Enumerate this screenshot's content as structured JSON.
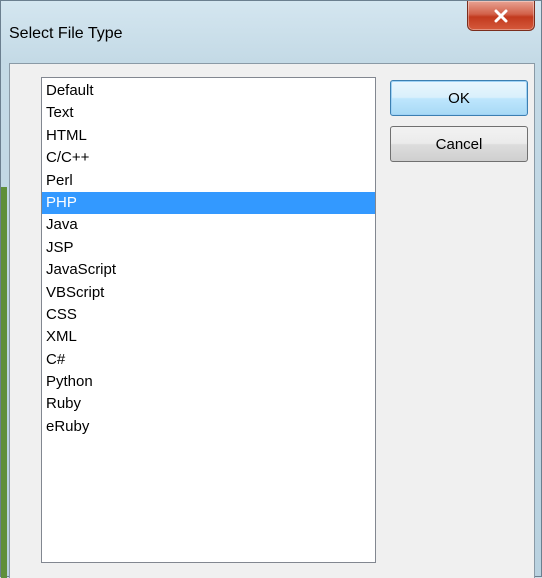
{
  "window": {
    "title": "Select File Type",
    "close_symbol": "x"
  },
  "list": {
    "items": [
      "Default",
      "Text",
      "HTML",
      "C/C++",
      "Perl",
      "PHP",
      "Java",
      "JSP",
      "JavaScript",
      "VBScript",
      "CSS",
      "XML",
      "C#",
      "Python",
      "Ruby",
      "eRuby"
    ],
    "selected_item": "PHP"
  },
  "buttons": {
    "ok_label": "OK",
    "cancel_label": "Cancel"
  },
  "colors": {
    "selection": "#3399ff",
    "close_button": "#c23a1e"
  },
  "icons": {
    "close": "close-icon"
  }
}
